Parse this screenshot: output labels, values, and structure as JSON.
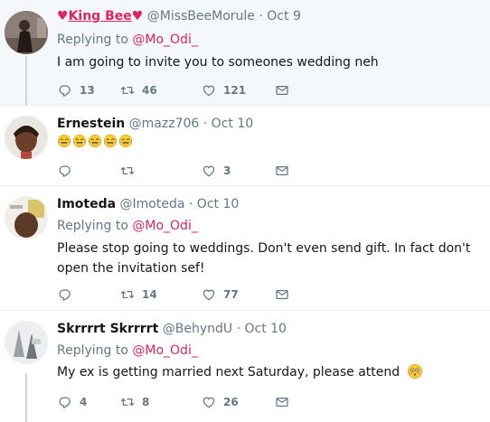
{
  "tweets": [
    {
      "name_prefix": "♥",
      "name": "King Bee",
      "name_suffix": "♥",
      "handle": "@MissBeeMorule",
      "dot": "·",
      "date": "Oct 9",
      "replying_label": "Replying to",
      "replying_to": "@Mo_Odi_",
      "text": "I am going to invite you to someones wedding neh",
      "replies": "13",
      "retweets": "46",
      "likes": "121"
    },
    {
      "name": "Ernestein",
      "handle": "@mazz706",
      "dot": "·",
      "date": "Oct 10",
      "replies": "",
      "retweets": "",
      "likes": "3"
    },
    {
      "name": "Imoteda",
      "handle": "@Imoteda",
      "dot": "·",
      "date": "Oct 10",
      "replying_label": "Replying to",
      "replying_to": "@Mo_Odi_",
      "text": "Please stop going to weddings. Don't even send gift. In fact don't open the invitation sef!",
      "replies": "",
      "retweets": "14",
      "likes": "77"
    },
    {
      "name": "Skrrrrt Skrrrrt",
      "handle": "@BehyndU",
      "dot": "·",
      "date": "Oct 10",
      "replying_label": "Replying to",
      "replying_to": "@Mo_Odi_",
      "text": "My ex is getting married next Saturday, please attend",
      "replies": "4",
      "retweets": "8",
      "likes": "26"
    }
  ],
  "icons": {
    "reply": "reply-icon",
    "retweet": "retweet-icon",
    "like": "heart-icon",
    "dm": "envelope-icon",
    "tears_of_joy": "face-with-tears-of-joy-emoji",
    "flushed": "flushed-face-emoji"
  },
  "colors": {
    "accent": "#e0245e",
    "muted": "#657786",
    "text": "#14171a",
    "highlight_bg": "#f5f8fa",
    "divider": "#e6ecf0"
  }
}
